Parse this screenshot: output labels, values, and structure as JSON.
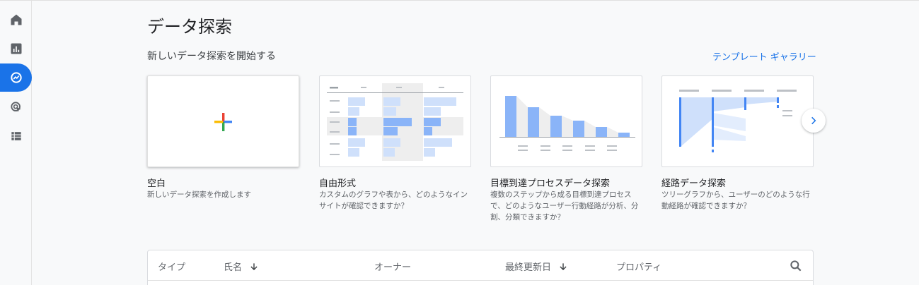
{
  "rail": {
    "items": [
      {
        "icon": "home-icon"
      },
      {
        "icon": "reports-icon"
      },
      {
        "icon": "explore-icon",
        "active": true
      },
      {
        "icon": "advertising-icon"
      },
      {
        "icon": "configure-icon"
      }
    ],
    "accent": "#1a73e8"
  },
  "page": {
    "title": "データ探索",
    "subtitle": "新しいデータ探索を開始する",
    "gallery_link": "テンプレート ギャラリー"
  },
  "cards": [
    {
      "title": "空白",
      "desc": "新しいデータ探索を作成します",
      "icon": "plus-icon"
    },
    {
      "title": "自由形式",
      "desc": "カスタムのグラフや表から、どのようなインサイトが確認できますか？",
      "icon": "freeform-thumbnail"
    },
    {
      "title": "目標到達プロセスデータ探索",
      "desc": "複数のステップから成る目標到達プロセスで、どのようなユーザー行動経路が分析、分割、分類できますか？",
      "icon": "funnel-thumbnail"
    },
    {
      "title": "経路データ探索",
      "desc": "ツリーグラフから、ユーザーのどのような行動経路が確認できますか？",
      "icon": "path-thumbnail"
    }
  ],
  "table": {
    "headers": {
      "type": "タイプ",
      "name": "氏名",
      "owner": "オーナー",
      "last_modified": "最終更新日",
      "property": "プロパティ"
    }
  }
}
